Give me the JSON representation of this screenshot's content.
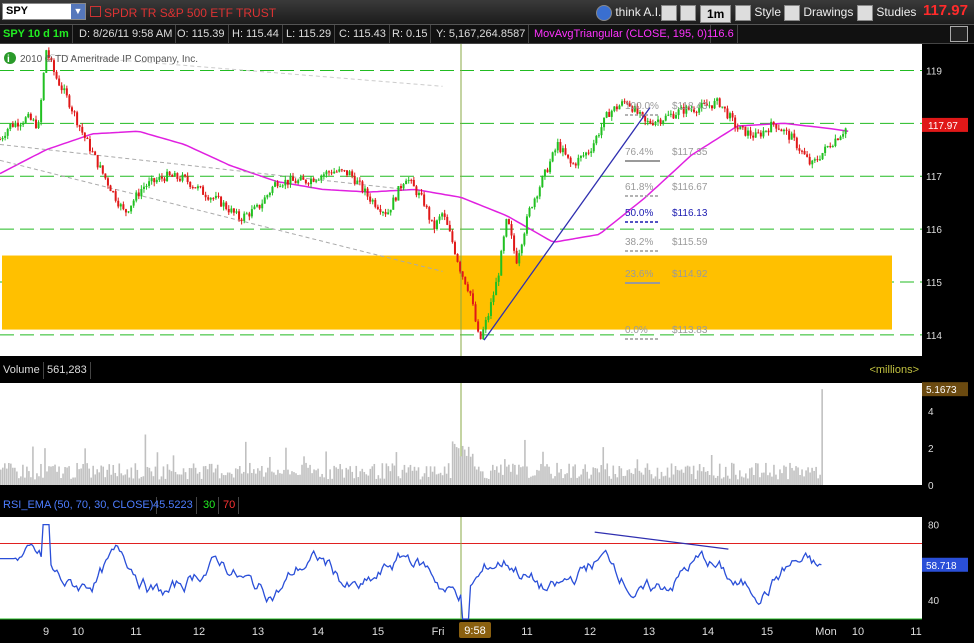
{
  "header": {
    "symbol": "SPY",
    "description": "SPDR TR S&P 500 ETF TRUST",
    "think_ai": "think A.I.",
    "timeframe": "1m",
    "style": "Style",
    "drawings": "Drawings",
    "studies": "Studies",
    "last_price": "117.97"
  },
  "info": {
    "range": "SPY 10 d 1m",
    "date": "D: 8/26/11 9:58 AM",
    "open": "O: 115.39",
    "high": "H: 115.44",
    "low": "L: 115.29",
    "close": "C: 115.43",
    "r": "R: 0.15",
    "y": "Y: 5,167,264.8587",
    "study": "MovAvgTriangular (CLOSE, 195, 0)",
    "study_value": "116.6"
  },
  "copyright": "2010 © TD Ameritrade IP Company, Inc.",
  "volume_header": {
    "label": "Volume",
    "value": "561,283",
    "units": "<millions>"
  },
  "rsi_header": {
    "label": "RSI_EMA (50, 70, 30, CLOSE)",
    "value": "45.5223",
    "low": "30",
    "high": "70"
  },
  "colors": {
    "up": "#21c021",
    "down": "#e01818",
    "ma": "#e020e0",
    "fib": "#9a9a9a",
    "fib_mid": "#1a1ab0",
    "zone": "#ffc000",
    "grid": "#22bb22",
    "rsi": "#2a4fd8",
    "volume": "#c0c0c0",
    "trend": "#2f2fb0"
  },
  "chart_data": [
    {
      "type": "candlestick",
      "symbol": "SPY",
      "yticks": [
        114,
        115,
        116,
        117,
        118,
        119
      ],
      "ylim": [
        113.6,
        119.5
      ],
      "price_label": "117.97",
      "x_labels": [
        "9",
        "10",
        "11",
        "12",
        "13",
        "14",
        "15",
        "Fri",
        "11",
        "12",
        "13",
        "14",
        "15",
        "Mon",
        "10",
        "11"
      ],
      "cursor_label": "9:58",
      "fibonacci": [
        {
          "ratio": "100.0%",
          "price": "$118.43"
        },
        {
          "ratio": "76.4%",
          "price": "$117.35"
        },
        {
          "ratio": "61.8%",
          "price": "$116.67"
        },
        {
          "ratio": "50.0%",
          "price": "$116.13"
        },
        {
          "ratio": "38.2%",
          "price": "$115.59"
        },
        {
          "ratio": "23.6%",
          "price": "$114.92"
        },
        {
          "ratio": "0.0%",
          "price": "$113.83"
        }
      ],
      "support_zone": [
        114.1,
        115.5
      ],
      "price_path": [
        [
          0,
          117.7
        ],
        [
          0.01,
          117.95
        ],
        [
          0.03,
          118.1
        ],
        [
          0.042,
          117.95
        ],
        [
          0.05,
          119.4
        ],
        [
          0.06,
          118.9
        ],
        [
          0.075,
          118.4
        ],
        [
          0.09,
          117.8
        ],
        [
          0.11,
          117.1
        ],
        [
          0.135,
          116.3
        ],
        [
          0.155,
          116.8
        ],
        [
          0.18,
          117.0
        ],
        [
          0.2,
          116.95
        ],
        [
          0.22,
          116.7
        ],
        [
          0.24,
          116.5
        ],
        [
          0.26,
          116.2
        ],
        [
          0.28,
          116.4
        ],
        [
          0.3,
          116.9
        ],
        [
          0.33,
          116.9
        ],
        [
          0.36,
          117.1
        ],
        [
          0.38,
          117.05
        ],
        [
          0.4,
          116.6
        ],
        [
          0.42,
          116.3
        ],
        [
          0.44,
          117.0
        ],
        [
          0.46,
          116.5
        ],
        [
          0.47,
          116.0
        ],
        [
          0.48,
          116.3
        ],
        [
          0.49,
          115.8
        ],
        [
          0.5,
          115.2
        ],
        [
          0.51,
          114.8
        ],
        [
          0.52,
          113.85
        ],
        [
          0.53,
          114.4
        ],
        [
          0.54,
          115.1
        ],
        [
          0.55,
          116.2
        ],
        [
          0.56,
          115.4
        ],
        [
          0.575,
          116.4
        ],
        [
          0.59,
          117.0
        ],
        [
          0.605,
          117.6
        ],
        [
          0.62,
          117.2
        ],
        [
          0.64,
          117.5
        ],
        [
          0.66,
          118.2
        ],
        [
          0.68,
          118.43
        ],
        [
          0.7,
          118.0
        ],
        [
          0.72,
          118.1
        ],
        [
          0.74,
          118.25
        ],
        [
          0.76,
          118.3
        ],
        [
          0.78,
          118.4
        ],
        [
          0.8,
          117.9
        ],
        [
          0.82,
          117.75
        ],
        [
          0.84,
          118.0
        ],
        [
          0.86,
          117.7
        ],
        [
          0.88,
          117.2
        ],
        [
          0.9,
          117.6
        ],
        [
          0.92,
          117.95
        ]
      ],
      "ma_path": [
        [
          0,
          117.05
        ],
        [
          0.05,
          117.5
        ],
        [
          0.1,
          117.8
        ],
        [
          0.15,
          117.85
        ],
        [
          0.2,
          117.6
        ],
        [
          0.25,
          117.2
        ],
        [
          0.3,
          116.9
        ],
        [
          0.35,
          116.75
        ],
        [
          0.4,
          116.7
        ],
        [
          0.45,
          116.75
        ],
        [
          0.5,
          116.6
        ],
        [
          0.55,
          116.25
        ],
        [
          0.6,
          115.75
        ],
        [
          0.65,
          115.9
        ],
        [
          0.7,
          116.6
        ],
        [
          0.75,
          117.4
        ],
        [
          0.8,
          117.95
        ],
        [
          0.85,
          118.0
        ],
        [
          0.9,
          117.9
        ],
        [
          0.92,
          117.85
        ]
      ],
      "trendline": [
        [
          0.525,
          113.9
        ],
        [
          0.705,
          118.3
        ]
      ]
    },
    {
      "type": "bar",
      "name": "Volume",
      "yticks": [
        0,
        2,
        4
      ],
      "ylim": [
        0,
        5.5
      ],
      "last_value": "5.1673"
    },
    {
      "type": "line",
      "name": "RSI_EMA",
      "yticks": [
        40,
        80
      ],
      "ylim": [
        30,
        84
      ],
      "overbought": 70,
      "oversold": 30,
      "last_value": "58.718"
    }
  ]
}
